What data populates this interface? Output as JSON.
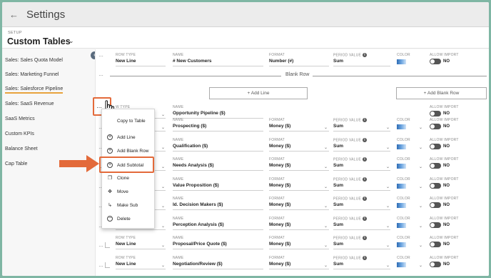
{
  "header": {
    "back_icon": "arrow-left-icon",
    "title": "Settings"
  },
  "subheader": {
    "setup_label": "SETUP",
    "page_title": "Custom Tables",
    "dropdown_icon": "chevron-down-icon"
  },
  "sidebar": {
    "items": [
      {
        "label": "Sales: Sales Quota Model"
      },
      {
        "label": "Sales: Marketing Funnel"
      },
      {
        "label": "Sales: Salesforce Pipeline",
        "active": true
      },
      {
        "label": "Sales: SaaS Revenue"
      },
      {
        "label": "SaaS Metrics"
      },
      {
        "label": "Custom KPIs"
      },
      {
        "label": "Balance Sheet"
      },
      {
        "label": "Cap Table"
      }
    ],
    "collapse_icon": "chevron-left-icon"
  },
  "field_labels": {
    "row_type": "ROW TYPE",
    "name": "NAME",
    "format": "FORMAT",
    "period_value": "PERIOD VALUE",
    "color": "COLOR",
    "allow_import": "ALLOW IMPORT"
  },
  "top_row": {
    "row_type": "New Line",
    "name": "# New Customers",
    "format": "Number (#)",
    "period_value": "Sum",
    "allow_import": "NO"
  },
  "blank_row_label": "Blank Row",
  "add_line_button": "+ Add Line",
  "add_blank_row_button": "+ Add Blank Row",
  "header_row": {
    "row_type_partial": "W TYPE",
    "name": "Opportunity Pipeline ($)",
    "allow_import": "NO"
  },
  "rows": [
    {
      "row_type": "",
      "name": "Prospecting ($)",
      "format": "Money ($)",
      "period_value": "Sum",
      "allow_import": "NO"
    },
    {
      "row_type": "",
      "name": "Qualification ($)",
      "format": "Money ($)",
      "period_value": "Sum",
      "allow_import": "NO"
    },
    {
      "row_type": "",
      "name": "Needs Analysis ($)",
      "format": "Money ($)",
      "period_value": "Sum",
      "allow_import": "NO"
    },
    {
      "row_type": "",
      "name": "Value Proposition ($)",
      "format": "Money ($)",
      "period_value": "Sum",
      "allow_import": "NO"
    },
    {
      "row_type": "",
      "name": "Id. Decision Makers ($)",
      "format": "Money ($)",
      "period_value": "Sum",
      "allow_import": "NO"
    },
    {
      "row_type": "",
      "name": "Perception Analysis ($)",
      "format": "Money ($)",
      "period_value": "Sum",
      "allow_import": "NO"
    },
    {
      "row_type": "New Line",
      "name": "Proposal/Price Quote ($)",
      "format": "Money ($)",
      "period_value": "Sum",
      "allow_import": "NO"
    },
    {
      "row_type": "New Line",
      "name": "Negotiation/Review ($)",
      "format": "Money ($)",
      "period_value": "Sum",
      "allow_import": "NO"
    }
  ],
  "context_menu": {
    "items": [
      {
        "label": "Copy to Table",
        "icon": "copy-icon"
      },
      {
        "label": "Add Line",
        "icon": "plus-circle-icon"
      },
      {
        "label": "Add Blank Row",
        "icon": "plus-circle-icon"
      },
      {
        "label": "Add Subtotal",
        "icon": "plus-circle-icon",
        "highlighted": true
      },
      {
        "label": "Clone",
        "icon": "clone-icon"
      },
      {
        "label": "Move",
        "icon": "move-icon"
      },
      {
        "label": "Make Sub",
        "icon": "indent-icon"
      },
      {
        "label": "Delete",
        "icon": "minus-circle-icon"
      }
    ]
  },
  "colors": {
    "annotation": "#e36a3a",
    "active_underline": "#e8a33d",
    "frame": "#7fb6a4"
  }
}
